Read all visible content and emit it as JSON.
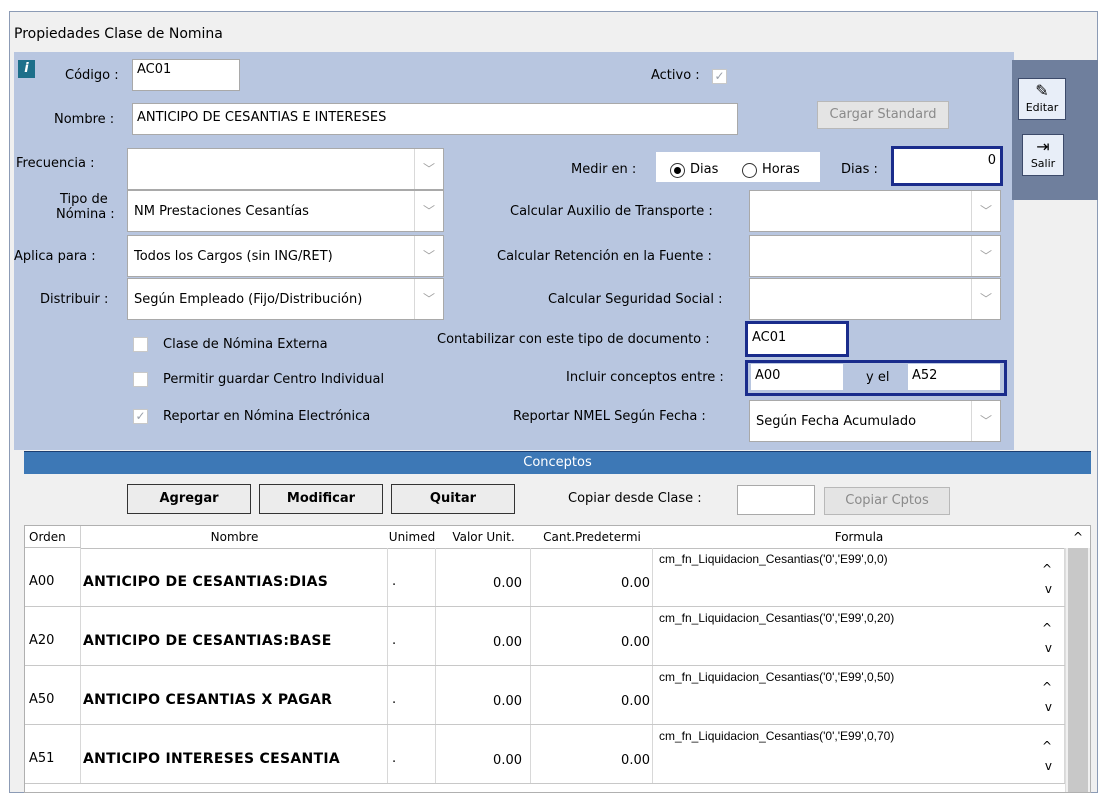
{
  "window": {
    "title": "Propiedades Clase de Nomina"
  },
  "form": {
    "codigo_label": "Código :",
    "codigo_value": "AC01",
    "activo_label": "Activo :",
    "activo_check": "✓",
    "nombre_label": "Nombre :",
    "nombre_value": "ANTICIPO DE CESANTIAS E INTERESES",
    "cargar_standard": "Cargar Standard",
    "frecuencia_label": "Frecuencia :",
    "frecuencia_value": "",
    "medir_label": "Medir en :",
    "medir_opt_dias": "Dias",
    "medir_opt_horas": "Horas",
    "dias_label": "Dias :",
    "dias_value": "0",
    "tipo_label_1": "Tipo de",
    "tipo_label_2": "Nómina :",
    "tipo_value": "NM Prestaciones Cesantías",
    "aux_transporte_label": "Calcular Auxilio de Transporte :",
    "aplica_label": "Aplica para :",
    "aplica_value": "Todos los Cargos (sin ING/RET)",
    "retencion_label": "Calcular Retención en la Fuente :",
    "distribuir_label": "Distribuir :",
    "distribuir_value": "Según Empleado (Fijo/Distribución)",
    "seguridad_label": "Calcular Seguridad Social :",
    "externa_label": "Clase de Nómina Externa",
    "contabilizar_label": "Contabilizar con este tipo de documento :",
    "contabilizar_value": "AC01",
    "centro_label": "Permitir guardar Centro Individual",
    "incluir_label": "Incluir conceptos entre :",
    "incluir_from": "A00",
    "incluir_y": "y el",
    "incluir_to": "A52",
    "reportar_label": "Reportar en Nómina Electrónica",
    "reportar_check": "✓",
    "nmel_label": "Reportar NMEL Según Fecha :",
    "nmel_value": "Según Fecha Acumulado",
    "combo_arrow": "﹀"
  },
  "toolbar": {
    "editar": "Editar",
    "salir": "Salir",
    "editar_icon": "✎",
    "salir_icon": "⇥"
  },
  "conceptos": {
    "section_title": "Conceptos",
    "agregar": "Agregar",
    "modificar": "Modificar",
    "quitar": "Quitar",
    "copiar_label": "Copiar desde Clase :",
    "copiar_value": "",
    "copiar_cptos": "Copiar Cptos",
    "headers": [
      "Orden",
      "Nombre",
      "Unimed",
      "Valor Unit.",
      "Cant.Predetermi",
      "Formula"
    ],
    "rows": [
      {
        "orden": "A00",
        "nombre": "ANTICIPO DE CESANTIAS:DIAS",
        "unimed": ".",
        "valor": "0.00",
        "cant": "0.00",
        "formula": "cm_fn_Liquidacion_Cesantias('0','E99',0,0)"
      },
      {
        "orden": "A20",
        "nombre": "ANTICIPO DE CESANTIAS:BASE",
        "unimed": ".",
        "valor": "0.00",
        "cant": "0.00",
        "formula": "cm_fn_Liquidacion_Cesantias('0','E99',0,20)"
      },
      {
        "orden": "A50",
        "nombre": "ANTICIPO CESANTIAS X PAGAR",
        "unimed": ".",
        "valor": "0.00",
        "cant": "0.00",
        "formula": "cm_fn_Liquidacion_Cesantias('0','E99',0,50)"
      },
      {
        "orden": "A51",
        "nombre": "ANTICIPO INTERESES CESANTIA",
        "unimed": ".",
        "valor": "0.00",
        "cant": "0.00",
        "formula": "cm_fn_Liquidacion_Cesantias('0','E99',0,70)"
      }
    ],
    "spin_up": "^",
    "spin_down": "v"
  },
  "colors": {
    "form_bg": "#b8c6e0",
    "section_bar": "#3d78b6",
    "highlight_border": "#1a2c8c"
  }
}
